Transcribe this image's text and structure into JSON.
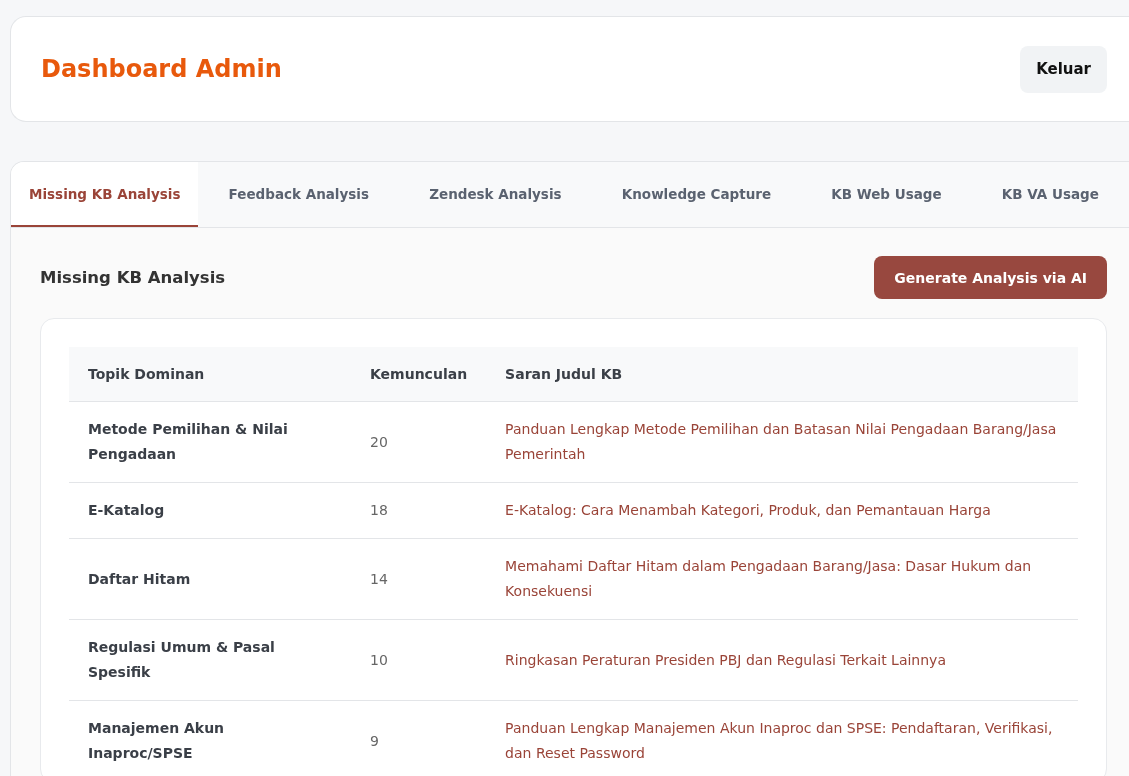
{
  "header": {
    "title": "Dashboard Admin",
    "logout_button": "Keluar"
  },
  "tabs": [
    {
      "label": "Missing KB Analysis",
      "selected": true
    },
    {
      "label": "Feedback Analysis",
      "selected": false
    },
    {
      "label": "Zendesk Analysis",
      "selected": false
    },
    {
      "label": "Knowledge Capture",
      "selected": false
    },
    {
      "label": "KB Web Usage",
      "selected": false
    },
    {
      "label": "KB VA Usage",
      "selected": false
    }
  ],
  "section": {
    "title": "Missing KB Analysis",
    "action_button": "Generate Analysis via AI"
  },
  "table": {
    "columns": [
      "Topik Dominan",
      "Kemunculan",
      "Saran Judul KB"
    ],
    "rows": [
      {
        "topic": "Metode Pemilihan & Nilai Pengadaan",
        "count": "20",
        "suggestion": "Panduan Lengkap Metode Pemilihan dan Batasan Nilai Pengadaan Barang/Jasa Pemerintah"
      },
      {
        "topic": "E-Katalog",
        "count": "18",
        "suggestion": "E-Katalog: Cara Menambah Kategori, Produk, dan Pemantauan Harga"
      },
      {
        "topic": "Daftar Hitam",
        "count": "14",
        "suggestion": "Memahami Daftar Hitam dalam Pengadaan Barang/Jasa: Dasar Hukum dan Konsekuensi"
      },
      {
        "topic": "Regulasi Umum & Pasal Spesifik",
        "count": "10",
        "suggestion": "Ringkasan Peraturan Presiden PBJ dan Regulasi Terkait Lainnya"
      },
      {
        "topic": "Manajemen Akun Inaproc/SPSE",
        "count": "9",
        "suggestion": "Panduan Lengkap Manajemen Akun Inaproc dan SPSE: Pendaftaran, Verifikasi, dan Reset Password"
      }
    ]
  }
}
